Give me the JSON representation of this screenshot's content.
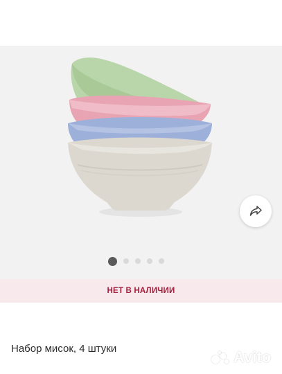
{
  "gallery": {
    "image": "stack-of-four-bowls",
    "bowl_colors": [
      "#b7d3a8",
      "#e9a6b4",
      "#9fb1d9",
      "#dcd8cf"
    ],
    "slide_count": 5,
    "active_slide": 1,
    "share_icon": "share-arrow-icon"
  },
  "availability": {
    "label": "НЕТ В НАЛИЧИИ",
    "color": "#a2203c",
    "background": "#f7e9ec"
  },
  "product": {
    "title": "Набор мисок, 4 штуки"
  },
  "watermark": {
    "text": "Avito",
    "logo": "avito-logo"
  }
}
